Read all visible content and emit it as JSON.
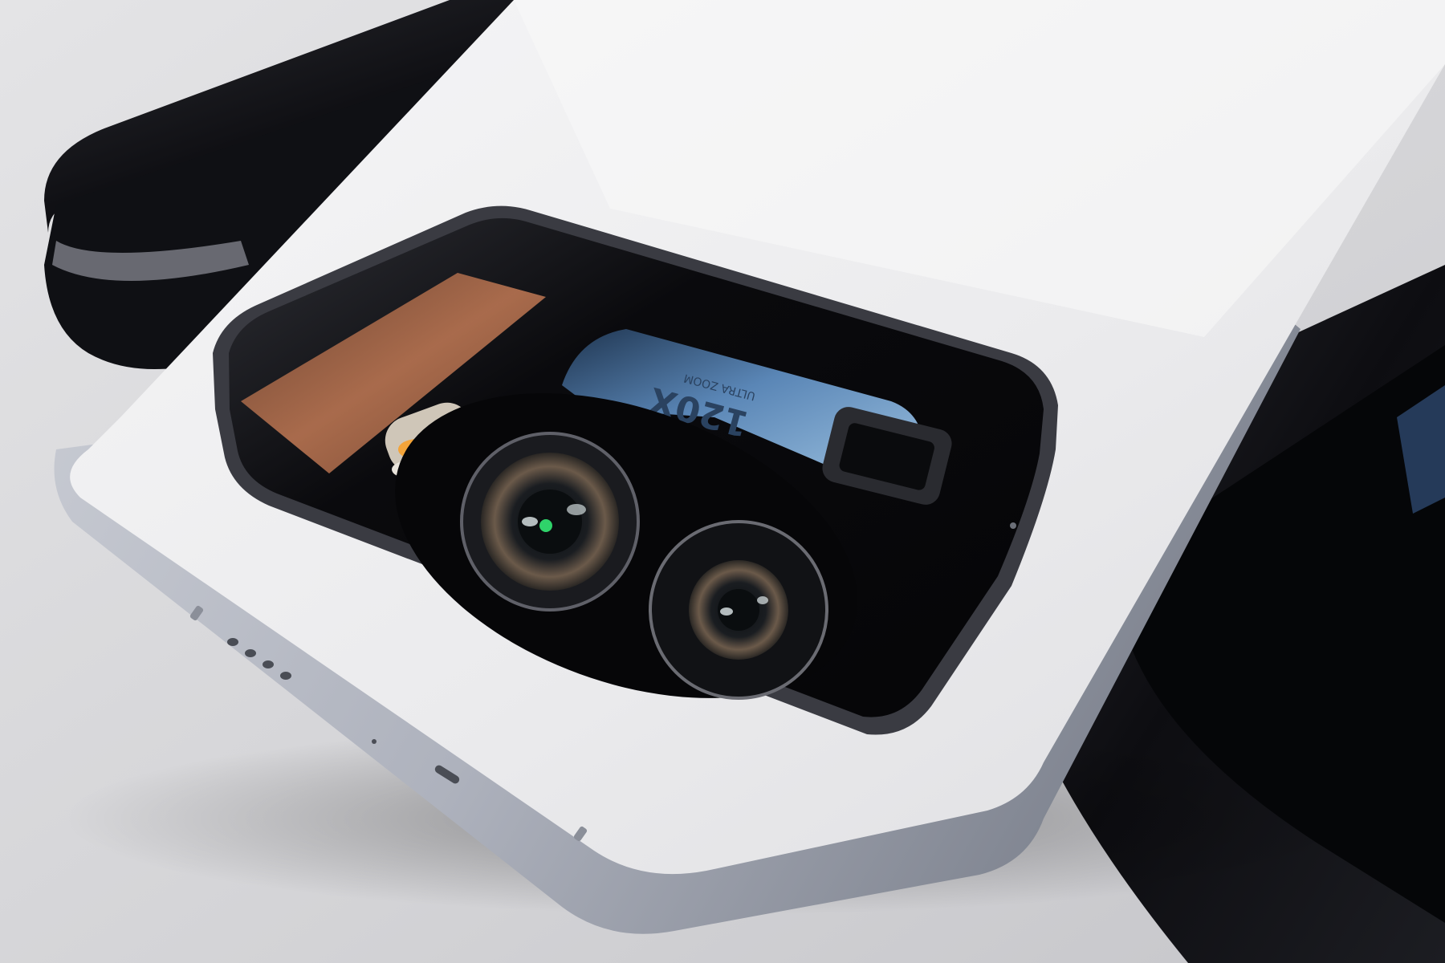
{
  "scene": {
    "description_label": "",
    "colors": {
      "table": "#d8d8db",
      "phone_white": "#ededee",
      "frame_silver": "#b9bcc6",
      "module_black": "#0c0c0f",
      "screen_blue": "#3f6a98",
      "orange_screen": "#c37a55",
      "flash_amber": "#f3a43a",
      "lens_green": "#2fd36a"
    },
    "icons": [
      "main-camera-lens-icon",
      "secondary-camera-lens-icon",
      "periscope-lens-icon",
      "led-flash-icon",
      "speaker-grille-icon"
    ],
    "module_text": {
      "line1": "120X",
      "line2": "ULTRA ZOOM"
    }
  }
}
